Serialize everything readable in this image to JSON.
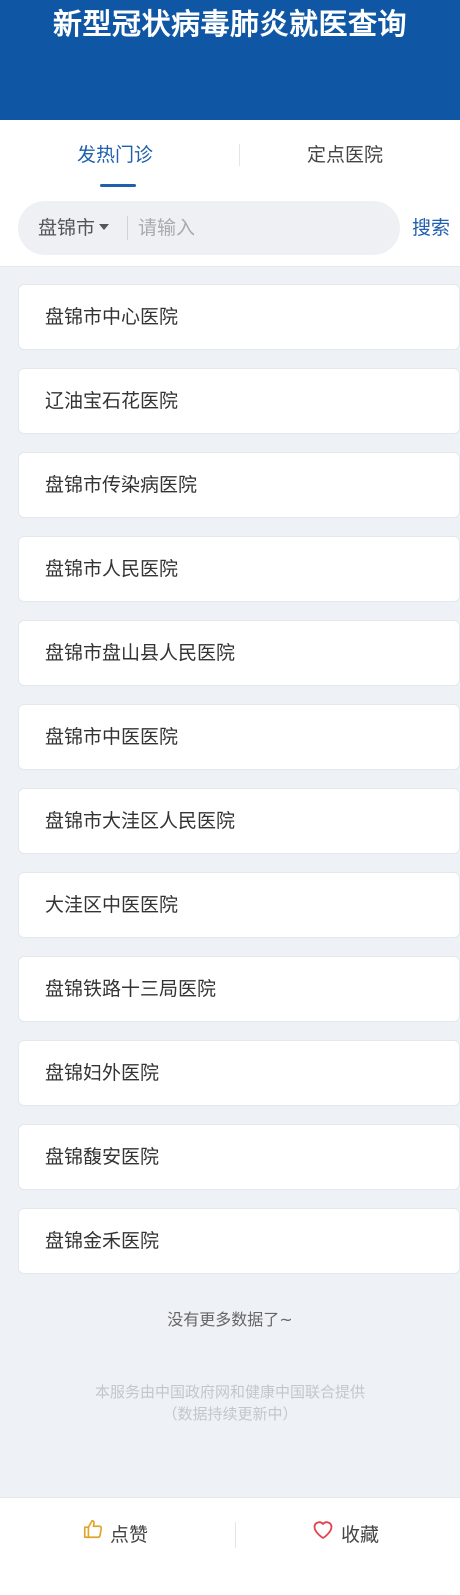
{
  "header": {
    "title": "新型冠状病毒肺炎就医查询"
  },
  "tabs": [
    {
      "label": "发热门诊",
      "active": true
    },
    {
      "label": "定点医院",
      "active": false
    }
  ],
  "search": {
    "city": "盘锦市",
    "placeholder": "请输入",
    "value": "",
    "button_label": "搜索"
  },
  "hospitals": [
    "盘锦市中心医院",
    "辽油宝石花医院",
    "盘锦市传染病医院",
    "盘锦市人民医院",
    "盘锦市盘山县人民医院",
    "盘锦市中医医院",
    "盘锦市大洼区人民医院",
    "大洼区中医医院",
    "盘锦铁路十三局医院",
    "盘锦妇外医院",
    "盘锦馥安医院",
    "盘锦金禾医院"
  ],
  "no_more_text": "没有更多数据了~",
  "footer_note": {
    "line1": "本服务由中国政府网和健康中国联合提供",
    "line2": "（数据持续更新中）"
  },
  "bottom_bar": {
    "like_label": "点赞",
    "like_icon": "thumbs-up-icon",
    "favorite_label": "收藏",
    "favorite_icon": "heart-icon"
  },
  "colors": {
    "header_bg": "#0f57a4",
    "accent": "#1f5fae",
    "like_icon": "#e0a42b",
    "favorite_icon": "#e0454f"
  }
}
